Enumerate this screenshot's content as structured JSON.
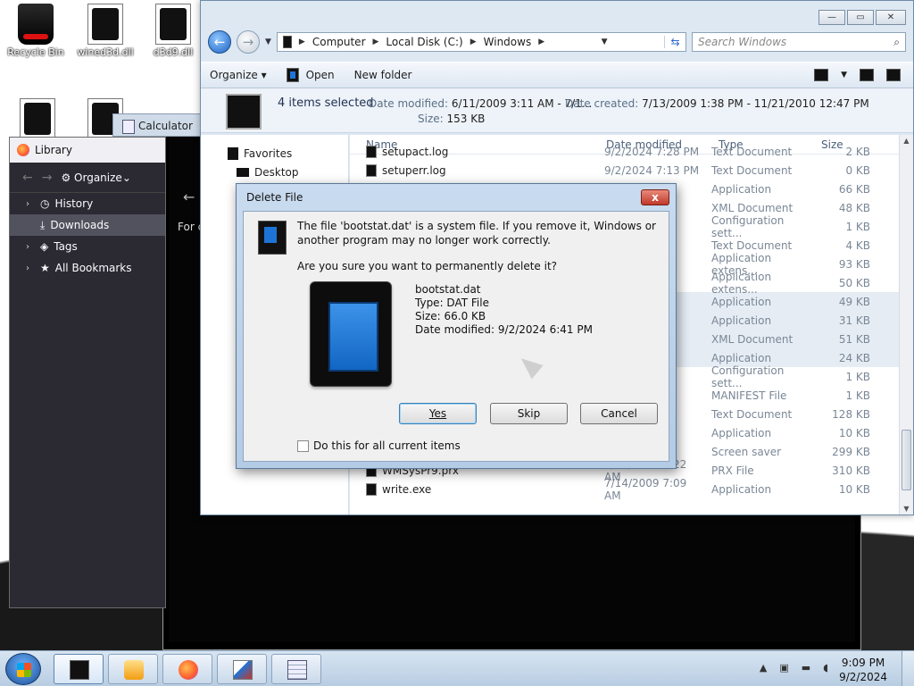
{
  "desktop": {
    "icons": [
      {
        "label": "Recycle Bin",
        "icon": "recycle-bin-icon"
      },
      {
        "label": "wined3d.dll",
        "icon": "dll-file-icon"
      },
      {
        "label": "d3d9.dll",
        "icon": "dll-file-icon"
      }
    ]
  },
  "calculator_stub": {
    "title": "Calculator"
  },
  "library": {
    "title": "Library",
    "toolbar": {
      "organize": "Organize"
    },
    "items": [
      {
        "label": "History",
        "icon": "clock-icon",
        "expandable": true
      },
      {
        "label": "Downloads",
        "icon": "download-icon",
        "expandable": false,
        "selected": true
      },
      {
        "label": "Tags",
        "icon": "tag-icon",
        "expandable": true
      },
      {
        "label": "All Bookmarks",
        "icon": "star-icon",
        "expandable": true
      }
    ]
  },
  "dark_window": {
    "partial_text": "For c"
  },
  "explorer": {
    "breadcrumb": [
      "Computer",
      "Local Disk (C:)",
      "Windows"
    ],
    "search_placeholder": "Search Windows",
    "toolbar": {
      "organize": "Organize",
      "open": "Open",
      "new_folder": "New folder"
    },
    "details": {
      "selection": "4 items selected",
      "date_modified_label": "Date modified:",
      "date_modified": "6/11/2009 3:11 AM - 7/1...",
      "date_created_label": "Date created:",
      "date_created": "7/13/2009 1:38 PM - 11/21/2010 12:47 PM",
      "size_label": "Size:",
      "size": "153 KB"
    },
    "nav": {
      "favorites": "Favorites",
      "desktop": "Desktop"
    },
    "columns": {
      "name": "Name",
      "date": "Date modified",
      "type": "Type",
      "size": "Size"
    },
    "rows": [
      {
        "name": "setupact.log",
        "date": "9/2/2024 7:28 PM",
        "type": "Text Document",
        "size": "2 KB"
      },
      {
        "name": "setuperr.log",
        "date": "9/2/2024 7:13 PM",
        "type": "Text Document",
        "size": "0 KB"
      },
      {
        "name": "",
        "date": "AM",
        "type": "Application",
        "size": "66 KB"
      },
      {
        "name": "",
        "date": "AM",
        "type": "XML Document",
        "size": "48 KB"
      },
      {
        "name": "",
        "date": "AM",
        "type": "Configuration sett...",
        "size": "1 KB"
      },
      {
        "name": "",
        "date": "AM",
        "type": "Text Document",
        "size": "4 KB"
      },
      {
        "name": "",
        "date": "AM",
        "type": "Application extens...",
        "size": "93 KB"
      },
      {
        "name": "",
        "date": "AM",
        "type": "Application extens...",
        "size": "50 KB"
      },
      {
        "name": "",
        "date": "AM",
        "type": "Application",
        "size": "49 KB",
        "selected": true
      },
      {
        "name": "",
        "date": "AM",
        "type": "Application",
        "size": "31 KB",
        "selected": true
      },
      {
        "name": "",
        "date": "AM",
        "type": "XML Document",
        "size": "51 KB",
        "selected": true
      },
      {
        "name": "",
        "date": "AM",
        "type": "Application",
        "size": "24 KB",
        "selected": true
      },
      {
        "name": "",
        "date": "AM",
        "type": "Configuration sett...",
        "size": "1 KB"
      },
      {
        "name": "",
        "date": "AM",
        "type": "MANIFEST File",
        "size": "1 KB"
      },
      {
        "name": "",
        "date": "AM",
        "type": "Text Document",
        "size": "128 KB"
      },
      {
        "name": "",
        "date": "AM",
        "type": "Application",
        "size": "10 KB"
      },
      {
        "name": "",
        "date": "AM",
        "type": "Screen saver",
        "size": "299 KB"
      },
      {
        "name": "WMSysPr9.prx",
        "date": "6/11/2009 2:22 AM",
        "type": "PRX File",
        "size": "310 KB"
      },
      {
        "name": "write.exe",
        "date": "7/14/2009 7:09 AM",
        "type": "Application",
        "size": "10 KB"
      }
    ]
  },
  "dialog": {
    "title": "Delete File",
    "close": "x",
    "message": "The file 'bootstat.dat' is a system file. If you remove it, Windows or another program may no longer work correctly.",
    "question": "Are you sure you want to permanently delete it?",
    "file": {
      "name": "bootstat.dat",
      "type": "Type: DAT File",
      "size": "Size: 66.0 KB",
      "modified": "Date modified: 9/2/2024 6:41 PM"
    },
    "buttons": {
      "yes": "Yes",
      "skip": "Skip",
      "cancel": "Cancel"
    },
    "checkbox": "Do this for all current items"
  },
  "taskbar": {
    "time": "9:09 PM",
    "date": "9/2/2024",
    "items": [
      "explorer",
      "media-player",
      "firefox",
      "paint",
      "calculator"
    ]
  }
}
